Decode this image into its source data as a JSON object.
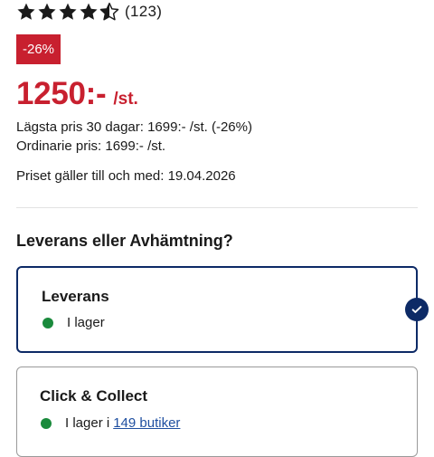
{
  "rating": {
    "stars": [
      "full",
      "full",
      "full",
      "full",
      "half"
    ],
    "value": 4.5,
    "max": 5,
    "count": "(123)"
  },
  "discount_badge": "-26%",
  "price": {
    "amount": "1250:-",
    "unit": "/st."
  },
  "lowest_price_30_days": "Lägsta pris 30 dagar: 1699:- /st. (-26%)",
  "regular_price": "Ordinarie pris: 1699:- /st.",
  "valid_until": "Priset gäller till och med: 19.04.2026",
  "fulfillment": {
    "title": "Leverans eller Avhämtning?",
    "options": [
      {
        "title": "Leverans",
        "stock": "I lager",
        "selected": true
      },
      {
        "title": "Click & Collect",
        "stock_prefix": "I lager i",
        "stock_link": "149 butiker",
        "selected": false
      }
    ]
  },
  "colors": {
    "accent_red": "#c8202f",
    "selected_navy": "#0d2a66",
    "stock_green": "#1a8a3c",
    "link_blue": "#1f4fa0"
  },
  "icons": {
    "star": "star-icon",
    "half_star": "star-half-icon",
    "stock": "in-stock-dot-icon",
    "selected": "checkmark-icon"
  }
}
